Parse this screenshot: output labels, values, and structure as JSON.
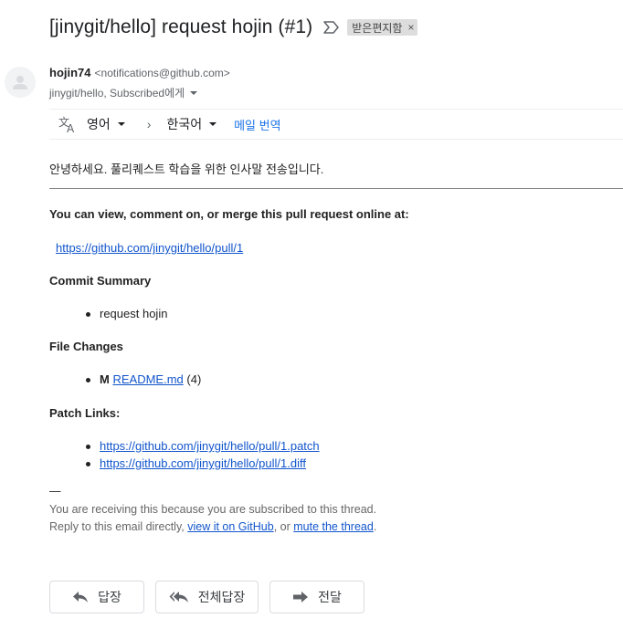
{
  "subject": {
    "title": "[jinygit/hello] request hojin (#1)",
    "label_chip": "받은편지함",
    "chip_close": "×"
  },
  "sender": {
    "name": "hojin74",
    "email": "<notifications@github.com>",
    "to_line": "jinygit/hello, Subscribed에게"
  },
  "translate_bar": {
    "from_lang": "영어",
    "arrow": "›",
    "to_lang": "한국어",
    "translate_link": "메일 번역"
  },
  "message": {
    "greeting": "안녕하세요. 풀리퀘스트 학습을 위한 인사말 전송입니다.",
    "view_heading": "You can view, comment on, or merge this pull request online at:",
    "pr_url": "https://github.com/jinygit/hello/pull/1",
    "commit_heading": "Commit Summary",
    "commits": [
      "request hojin"
    ],
    "file_heading": "File Changes",
    "file_change": {
      "status": "M",
      "file": "README.md",
      "count": "(4)"
    },
    "patch_heading": "Patch Links:",
    "patch_links": [
      "https://github.com/jinygit/hello/pull/1.patch",
      "https://github.com/jinygit/hello/pull/1.diff"
    ]
  },
  "footer": {
    "dash": "—",
    "receiving": "You are receiving this because you are subscribed to this thread.",
    "reply_prefix": "Reply to this email directly, ",
    "view_github": "view it on GitHub",
    "or": ", or ",
    "mute": "mute the thread",
    "period": "."
  },
  "actions": {
    "reply": "답장",
    "reply_all": "전체답장",
    "forward": "전달"
  },
  "colors": {
    "link": "#1155cc",
    "translate_link": "#1a73e8",
    "chip_bg": "#dddddd"
  }
}
